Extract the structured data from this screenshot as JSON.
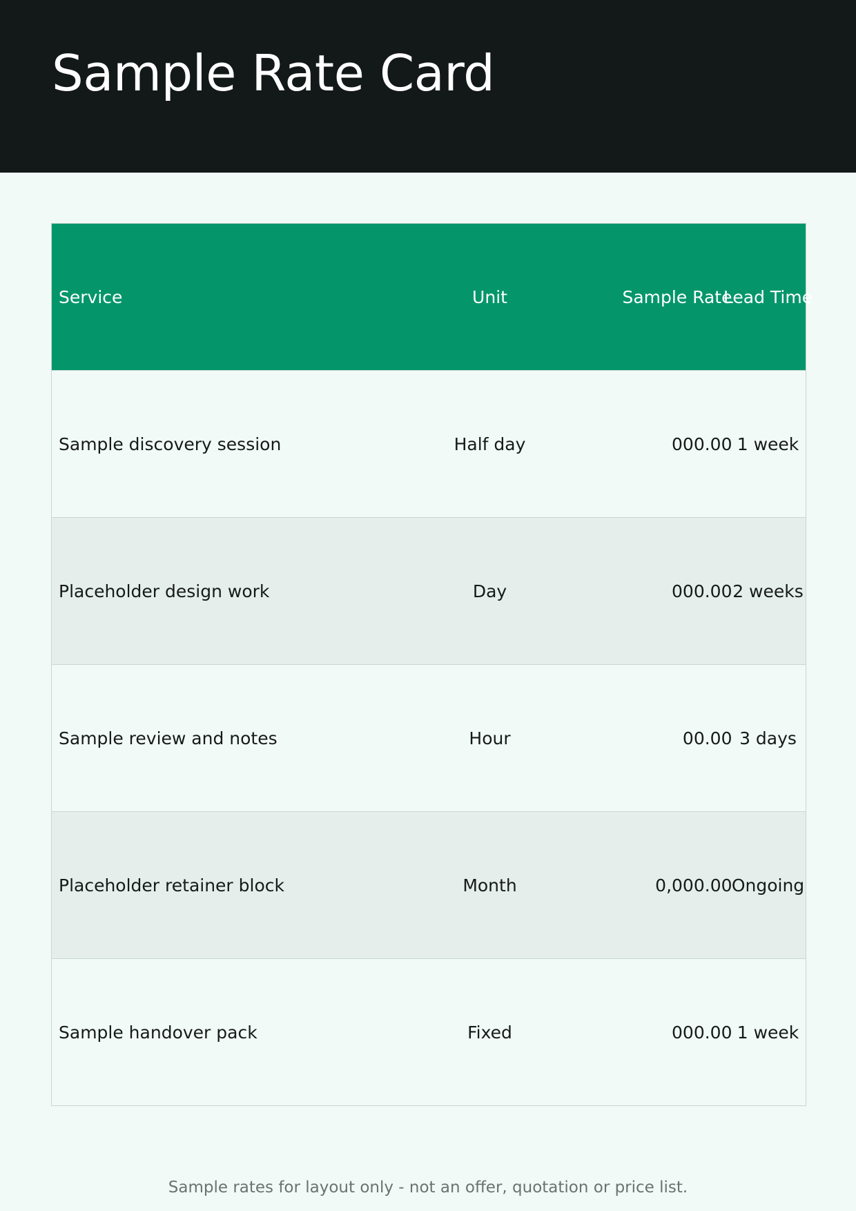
{
  "header": {
    "title": "Sample Rate Card"
  },
  "table": {
    "columns": {
      "service": "Service",
      "unit": "Unit",
      "rate": "Sample Rate",
      "lead_time": "Lead Time"
    },
    "rows": [
      {
        "service": "Sample discovery session",
        "unit": "Half day",
        "rate": "000.00",
        "lead_time": "1 week"
      },
      {
        "service": "Placeholder design work",
        "unit": "Day",
        "rate": "000.00",
        "lead_time": "2 weeks"
      },
      {
        "service": "Sample review and notes",
        "unit": "Hour",
        "rate": "00.00",
        "lead_time": "3 days"
      },
      {
        "service": "Placeholder retainer block",
        "unit": "Month",
        "rate": "0,000.00",
        "lead_time": "Ongoing"
      },
      {
        "service": "Sample handover pack",
        "unit": "Fixed",
        "rate": "000.00",
        "lead_time": "1 week"
      }
    ]
  },
  "footer": {
    "note": "Sample rates for layout only  -  not an offer, quotation or price list."
  },
  "colors": {
    "header_band": "#131918",
    "table_header": "#04966a",
    "page_background": "#f1faf6",
    "row_alt": "#e5eeeb"
  }
}
